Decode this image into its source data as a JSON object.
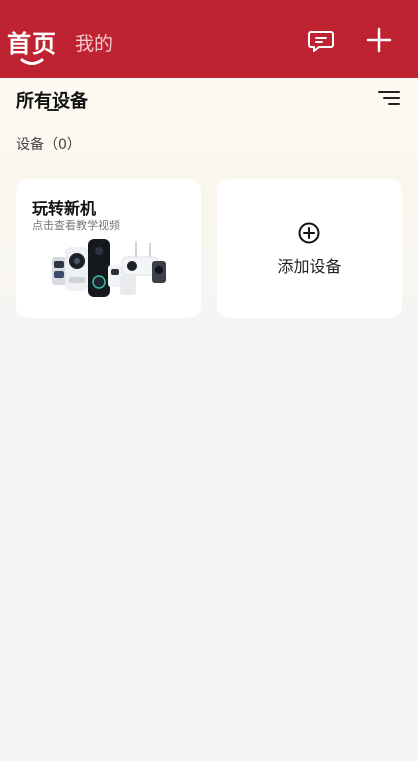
{
  "header": {
    "tabs": [
      {
        "label": "首页"
      },
      {
        "label": "我的"
      }
    ]
  },
  "main": {
    "section_title": "所有设备",
    "device_count_label": "设备（0）",
    "cards": {
      "newbie": {
        "title": "玩转新机",
        "subtitle": "点击查看教学视频"
      },
      "add_device": {
        "label": "添加设备"
      }
    }
  },
  "colors": {
    "header_bg": "#bf2230",
    "card_bg": "#ffffff",
    "page_bg": "#f5f5f5"
  },
  "icons": [
    "chevron-indicator-icon",
    "message-icon",
    "plus-icon",
    "sort-icon",
    "add-circle-icon"
  ]
}
